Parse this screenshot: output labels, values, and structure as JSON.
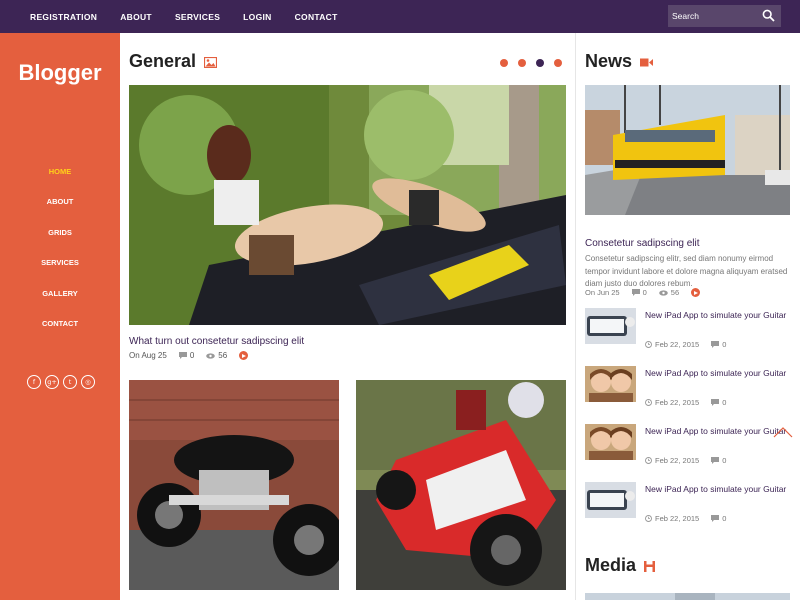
{
  "topnav": {
    "items": [
      "REGISTRATION",
      "ABOUT",
      "SERVICES",
      "LOGIN",
      "CONTACT"
    ]
  },
  "search": {
    "placeholder": "Search",
    "icon": "search-icon"
  },
  "sidebar": {
    "logo": "Blogger",
    "items": [
      "HOME",
      "ABOUT",
      "GRIDS",
      "SERVICES",
      "GALLERY",
      "CONTACT"
    ],
    "active_index": 0,
    "social": [
      {
        "icon": "facebook-icon",
        "glyph": "f"
      },
      {
        "icon": "google-plus-icon",
        "glyph": "g+"
      },
      {
        "icon": "twitter-icon",
        "glyph": "t"
      },
      {
        "icon": "dribbble-icon",
        "glyph": "◎"
      }
    ]
  },
  "general": {
    "title": "General",
    "title_icon": "image-icon",
    "slider_dots": 4,
    "active_dot": 2,
    "featured": {
      "image": "woman-on-motorcycle-photo",
      "title": "What turn out consetetur sadipscing elit",
      "date": "On Aug 25",
      "comments": "0",
      "views": "56"
    },
    "grid_images": [
      "black-cruiser-motorcycle-photo",
      "red-racing-motorcycle-photo"
    ]
  },
  "news": {
    "title": "News",
    "title_icon": "video-icon",
    "featured": {
      "image": "yellow-tram-photo",
      "title": "Consetetur sadipscing elit",
      "text": "Consetetur sadipscing elitr, sed diam nonumy eirmod tempor invidunt labore et dolore magna aliquyam eratsed diam justo duo dolores rebum.",
      "date": "On Jun 25",
      "comments": "0",
      "views": "56"
    },
    "items": [
      {
        "thumb": "ipad-guitar-thumb",
        "title": "New iPad App to simulate your Guitar",
        "date": "Feb 22, 2015",
        "comments": "0"
      },
      {
        "thumb": "two-girls-thumb",
        "title": "New iPad App to simulate your Guitar",
        "date": "Feb 22, 2015",
        "comments": "0"
      },
      {
        "thumb": "two-girls-thumb",
        "title": "New iPad App to simulate your Guitar",
        "date": "Feb 22, 2015",
        "comments": "0"
      },
      {
        "thumb": "ipad-guitar-thumb",
        "title": "New iPad App to simulate your Guitar",
        "date": "Feb 22, 2015",
        "comments": "0"
      }
    ]
  },
  "media": {
    "title": "Media",
    "title_icon": "save-icon"
  },
  "colors": {
    "topbar": "#3d2555",
    "accent": "#e45f3e",
    "active_nav": "#ffd11a"
  }
}
